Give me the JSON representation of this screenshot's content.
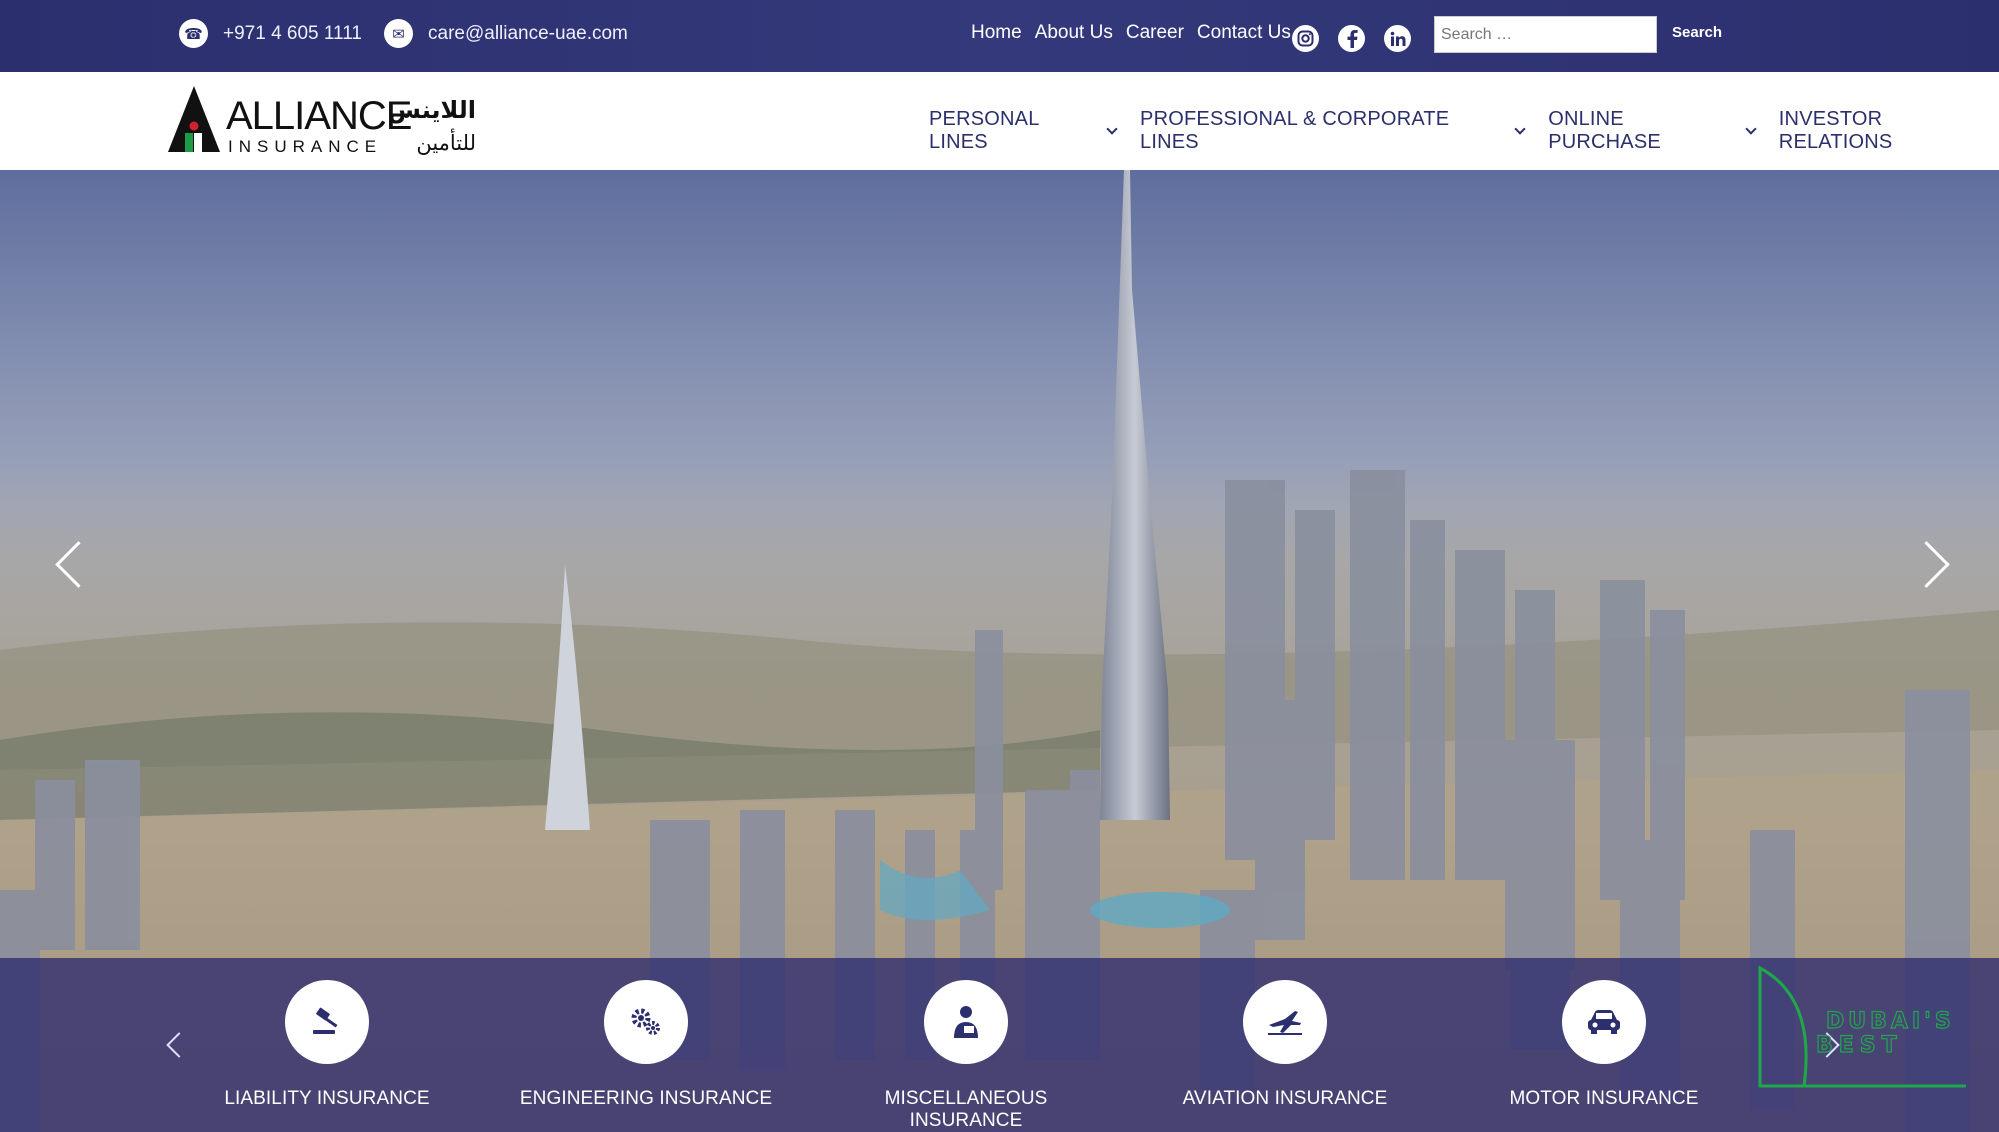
{
  "topbar": {
    "phone": "+971 4 605 1111",
    "email": "care@alliance-uae.com",
    "links": [
      "Home",
      "About Us",
      "Career",
      "Contact Us"
    ],
    "social_icons": [
      "instagram-icon",
      "facebook-icon",
      "linkedin-icon"
    ],
    "search_placeholder": "Search …",
    "search_button": "Search"
  },
  "logo": {
    "name": "ALLIANCE",
    "sub": "INSURANCE",
    "arabic_top": "اللاينس",
    "arabic_bottom": "للتأمين"
  },
  "nav": {
    "items": [
      {
        "label": "PERSONAL LINES",
        "dropdown": true
      },
      {
        "label": "PROFESSIONAL & CORPORATE LINES",
        "dropdown": true
      },
      {
        "label": "ONLINE PURCHASE",
        "dropdown": true
      },
      {
        "label": "INVESTOR RELATIONS",
        "dropdown": false
      }
    ]
  },
  "services": [
    {
      "label": "LIABILITY INSURANCE",
      "icon": "gavel-icon"
    },
    {
      "label": "ENGINEERING INSURANCE",
      "icon": "gears-icon"
    },
    {
      "label": "MISCELLANEOUS INSURANCE",
      "icon": "person-icon"
    },
    {
      "label": "AVIATION INSURANCE",
      "icon": "airplane-icon"
    },
    {
      "label": "MOTOR INSURANCE",
      "icon": "car-icon"
    }
  ],
  "watermark": {
    "text_top": "DUBAI'S",
    "text_bottom": "BEST"
  },
  "colors": {
    "navy": "#2c2f6e",
    "white": "#ffffff",
    "logo_red": "#d3202f",
    "logo_green": "#1e9a46",
    "watermark_green": "#1ea84a"
  }
}
